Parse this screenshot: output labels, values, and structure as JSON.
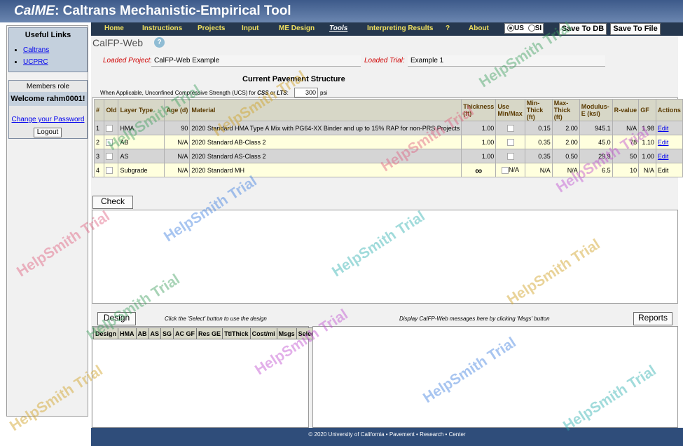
{
  "app": {
    "title_em": "CalME",
    "title_rest": ": Caltrans Mechanistic-Empirical Tool"
  },
  "sidebar": {
    "useful_links_title": "Useful Links",
    "links": [
      "Caltrans",
      "UCPRC"
    ],
    "members_role": "Members role",
    "welcome": "Welcome rahm0001!",
    "change_password": "Change your Password",
    "logout": "Logout"
  },
  "nav": {
    "items": [
      "Home",
      "Instructions",
      "Projects",
      "Input",
      "ME Design",
      "Tools",
      "Interpreting Results",
      "?",
      "About"
    ],
    "unit_us": "US",
    "unit_si": "SI",
    "save_db": "Save To DB",
    "save_file": "Save To File"
  },
  "main": {
    "tool_title": "CalFP-Web",
    "loaded_project_label": "Loaded Project:",
    "loaded_project_value": "CalFP-Web Example",
    "loaded_trial_label": "Loaded Trial:",
    "loaded_trial_value": "Example 1",
    "structure_title": "Current Pavement Structure",
    "ucs_pre": "When Applicable, Unconfined Compressive Strength (UCS) for ",
    "ucs_css": "CSS",
    "ucs_or": " or ",
    "ucs_lts": "LTS",
    "ucs_colon": ":",
    "ucs_value": "300",
    "ucs_unit": "psi"
  },
  "table": {
    "headers": [
      "#",
      "Old",
      "Layer Type",
      "Age (d)",
      "Material",
      "Thickness (ft)",
      "Use Min/Max",
      "Min-Thick (ft)",
      "Max-Thick (ft)",
      "Modulus-E (ksi)",
      "R-value",
      "GF",
      "Actions"
    ],
    "rows": [
      {
        "n": "1",
        "type": "HMA",
        "age": "90",
        "material": "2020 Standard HMA Type A Mix with PG64-XX Binder and up to 15% RAP for non-PRS Projects",
        "thick": "1.00",
        "use": "",
        "min": "0.15",
        "max": "2.00",
        "mod": "945.1",
        "r": "N/A",
        "gf": "1.98",
        "act": "Edit"
      },
      {
        "n": "2",
        "type": "AB",
        "age": "N/A",
        "material": "2020 Standard AB-Class 2",
        "thick": "1.00",
        "use": "",
        "min": "0.35",
        "max": "2.00",
        "mod": "45.0",
        "r": "78",
        "gf": "1.10",
        "act": "Edit"
      },
      {
        "n": "3",
        "type": "AS",
        "age": "N/A",
        "material": "2020 Standard AS-Class 2",
        "thick": "1.00",
        "use": "",
        "min": "0.35",
        "max": "0.50",
        "mod": "29.9",
        "r": "50",
        "gf": "1.00",
        "act": "Edit"
      },
      {
        "n": "4",
        "type": "Subgrade",
        "age": "N/A",
        "material": "2020 Standard MH",
        "thick": "∞",
        "use": "N/A",
        "min": "N/A",
        "max": "N/A",
        "mod": "6.5",
        "r": "10",
        "gf": "N/A",
        "act": "Edit"
      }
    ]
  },
  "check": {
    "label": "Check"
  },
  "design": {
    "button": "Design",
    "hint": "Click the 'Select' button to use the design",
    "msg_hint": "Display CalFP-Web messages here by clicking 'Msgs' button",
    "reports": "Reports",
    "columns": [
      "Design",
      "HMA",
      "AB",
      "AS",
      "SG",
      "AC GF",
      "Res GE",
      "TtlThick",
      "Cost/mi",
      "Msgs",
      "Select"
    ]
  },
  "footer": {
    "text": "© 2020 University of California • Pavement • Research • Center"
  },
  "watermark": "HelpSmith Trial"
}
